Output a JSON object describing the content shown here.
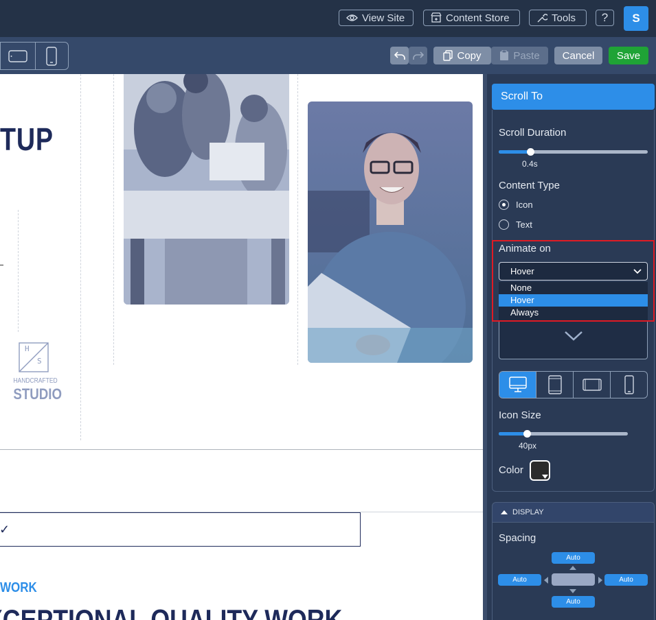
{
  "topbar": {
    "view_site": "View Site",
    "content_store": "Content Store",
    "tools": "Tools",
    "help": "?",
    "avatar": "S"
  },
  "toolbar": {
    "copy": "Copy",
    "paste": "Paste",
    "cancel": "Cancel",
    "save": "Save"
  },
  "canvas": {
    "heading_fragment": "TUP",
    "logo_letters": [
      "H",
      "S"
    ],
    "logo_line1": "HANDCRAFTED",
    "logo_line2": "STUDIO",
    "check_char": "✓",
    "eyebrow": "WORK",
    "big_heading": "XCEPTIONAL QUALITY WORK"
  },
  "panel": {
    "header": "Scroll To",
    "scroll_duration_label": "Scroll Duration",
    "scroll_duration_value": "0.4s",
    "scroll_duration_fraction": 0.21,
    "content_type_label": "Content Type",
    "content_type_options": [
      "Icon",
      "Text"
    ],
    "content_type_selected": "Icon",
    "animate_on_label": "Animate on",
    "animate_on_selected": "Hover",
    "animate_on_options": [
      "None",
      "Hover",
      "Always"
    ],
    "icon_preview": "chevron-down-icon",
    "device_icons": [
      "desktop-icon",
      "tablet-portrait-icon",
      "tablet-landscape-icon",
      "mobile-icon"
    ],
    "icon_size_label": "Icon Size",
    "icon_size_value": "40px",
    "icon_size_fraction": 0.22,
    "color_label": "Color",
    "color_value": "#2b2b2b",
    "display_section": "DISPLAY",
    "spacing_label": "Spacing",
    "spacing": {
      "top": "Auto",
      "left": "Auto",
      "right": "Auto",
      "bottom": "Auto"
    }
  },
  "colors": {
    "accent": "#2d8ee8",
    "save": "#1fa336",
    "highlight_border": "#e01b24",
    "heading": "#1e2a5a"
  }
}
